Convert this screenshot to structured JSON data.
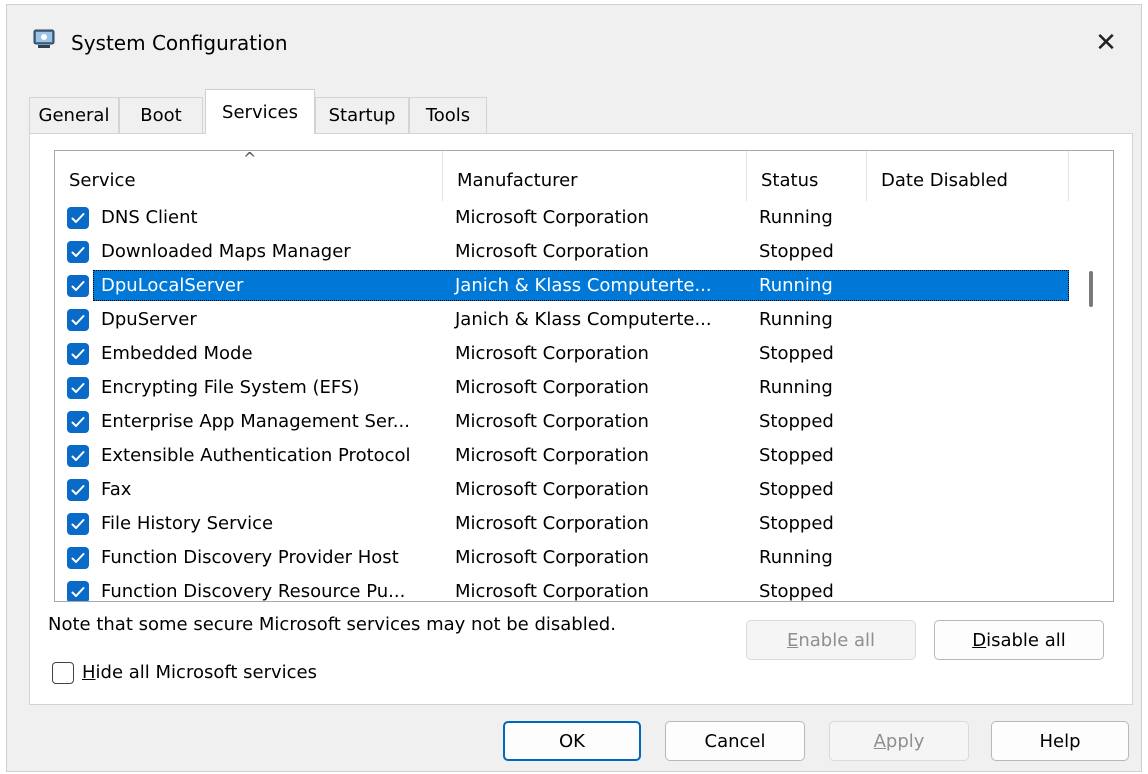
{
  "window": {
    "title": "System Configuration",
    "close_glyph": "✕"
  },
  "tabs": [
    {
      "label": "General"
    },
    {
      "label": "Boot"
    },
    {
      "label": "Services",
      "active": true
    },
    {
      "label": "Startup"
    },
    {
      "label": "Tools"
    }
  ],
  "table": {
    "sort_indicator": "^",
    "columns": [
      "Service",
      "Manufacturer",
      "Status",
      "Date Disabled"
    ],
    "rows": [
      {
        "service": "DNS Client",
        "manufacturer": "Microsoft Corporation",
        "status": "Running",
        "date_disabled": "",
        "checked": true
      },
      {
        "service": "Downloaded Maps Manager",
        "manufacturer": "Microsoft Corporation",
        "status": "Stopped",
        "date_disabled": "",
        "checked": true
      },
      {
        "service": "DpuLocalServer",
        "manufacturer": "Janich & Klass Computerte...",
        "status": "Running",
        "date_disabled": "",
        "checked": true,
        "selected": true
      },
      {
        "service": "DpuServer",
        "manufacturer": "Janich & Klass Computerte...",
        "status": "Running",
        "date_disabled": "",
        "checked": true
      },
      {
        "service": "Embedded Mode",
        "manufacturer": "Microsoft Corporation",
        "status": "Stopped",
        "date_disabled": "",
        "checked": true
      },
      {
        "service": "Encrypting File System (EFS)",
        "manufacturer": "Microsoft Corporation",
        "status": "Running",
        "date_disabled": "",
        "checked": true
      },
      {
        "service": "Enterprise App Management Ser...",
        "manufacturer": "Microsoft Corporation",
        "status": "Stopped",
        "date_disabled": "",
        "checked": true
      },
      {
        "service": "Extensible Authentication Protocol",
        "manufacturer": "Microsoft Corporation",
        "status": "Stopped",
        "date_disabled": "",
        "checked": true
      },
      {
        "service": "Fax",
        "manufacturer": "Microsoft Corporation",
        "status": "Stopped",
        "date_disabled": "",
        "checked": true
      },
      {
        "service": "File History Service",
        "manufacturer": "Microsoft Corporation",
        "status": "Stopped",
        "date_disabled": "",
        "checked": true
      },
      {
        "service": "Function Discovery Provider Host",
        "manufacturer": "Microsoft Corporation",
        "status": "Running",
        "date_disabled": "",
        "checked": true
      },
      {
        "service": "Function Discovery Resource Pu...",
        "manufacturer": "Microsoft Corporation",
        "status": "Stopped",
        "date_disabled": "",
        "checked": true
      }
    ]
  },
  "note": "Note that some secure Microsoft services may not be disabled.",
  "buttons": {
    "enable_all": {
      "label": "Enable all",
      "accel": "E",
      "rest": "nable all"
    },
    "disable_all": {
      "label": "Disable all",
      "accel": "D",
      "rest": "isable all"
    },
    "ok": "OK",
    "cancel": "Cancel",
    "apply": {
      "label": "Apply",
      "accel": "A",
      "rest": "pply"
    },
    "help": "Help"
  },
  "hide_ms": {
    "label": "Hide all Microsoft services",
    "accel": "H",
    "rest": "ide all Microsoft services",
    "checked": false
  },
  "colors": {
    "accent": "#0078d7",
    "checkbox": "#0a6ac7"
  }
}
